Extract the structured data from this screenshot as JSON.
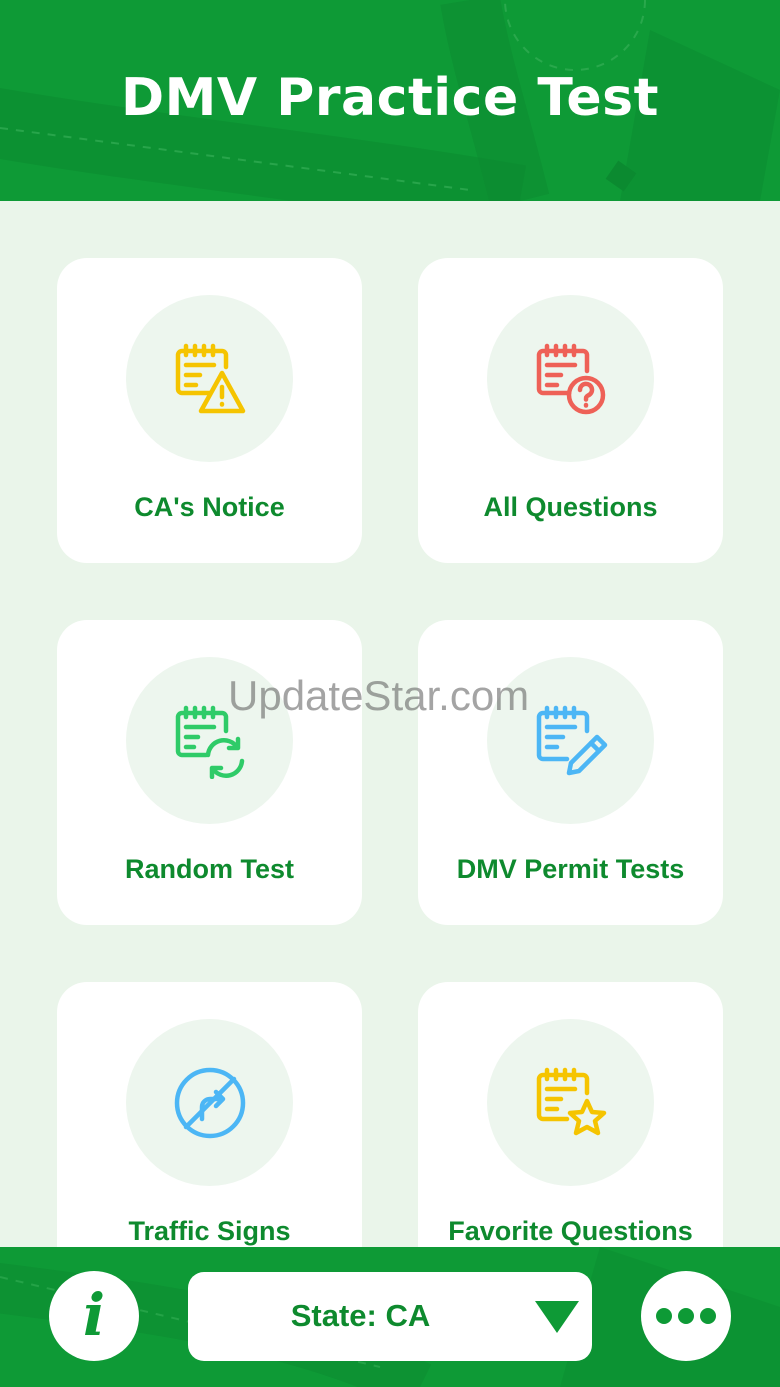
{
  "header": {
    "title": "DMV Practice Test"
  },
  "cards": [
    {
      "label": "CA's Notice",
      "icon": "notice-warning-icon",
      "color": "#f5c400"
    },
    {
      "label": "All Questions",
      "icon": "question-document-icon",
      "color": "#ee6157"
    },
    {
      "label": "Random Test",
      "icon": "random-refresh-icon",
      "color": "#2fcb68"
    },
    {
      "label": "DMV Permit Tests",
      "icon": "permit-edit-icon",
      "color": "#4cb6f5"
    },
    {
      "label": "Traffic Signs",
      "icon": "no-right-turn-sign-icon",
      "color": "#4cb6f5"
    },
    {
      "label": "Favorite Questions",
      "icon": "favorite-star-icon",
      "color": "#f5c400"
    }
  ],
  "watermark": "UpdateStar.com",
  "footer": {
    "state_label": "State: CA",
    "info_icon": "info-icon",
    "more_icon": "more-dots-icon"
  },
  "colors": {
    "brand_green": "#0e9a36",
    "background": "#eaf5ea",
    "label_green": "#0e8a2e"
  }
}
